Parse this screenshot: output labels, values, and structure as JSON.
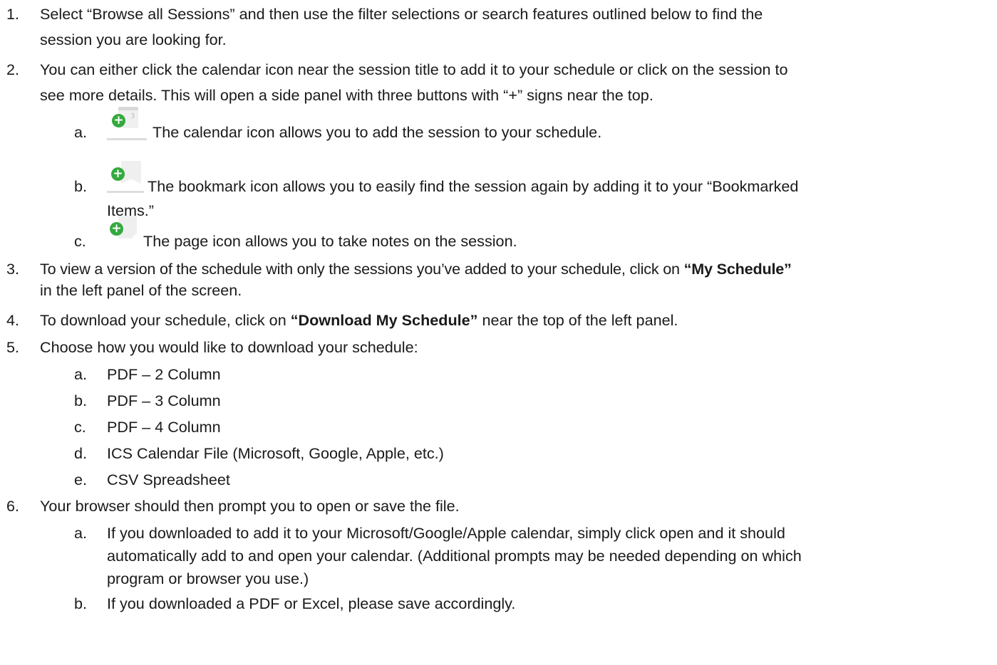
{
  "steps": [
    {
      "num": "1.",
      "line1": "Select “Browse all Sessions” and then use the filter selections or search features outlined below to find the",
      "line2": "session you are looking for."
    },
    {
      "num": "2.",
      "line1": "You can either click the calendar icon near the session title to add it to your schedule or click on the session to",
      "line2": "see more details. This will open a side panel with three buttons with “+” signs near the top.",
      "subs": [
        {
          "letter": "a.",
          "icon": "calendar-add-icon",
          "calendar_number": "3",
          "text": "The calendar icon allows you to add the session to your schedule."
        },
        {
          "letter": "b.",
          "icon": "bookmark-add-icon",
          "text": "The bookmark icon allows you to easily find the session again by adding it to your “Bookmarked",
          "text2": "Items.”"
        },
        {
          "letter": "c.",
          "icon": "page-add-icon",
          "text": "The page icon allows you to take notes on the session."
        }
      ]
    },
    {
      "num": "3.",
      "line1_pre": "To view a version of the schedule with only the sessions you’ve added to your schedule, click on ",
      "line1_bold": "“My Schedule”",
      "line2": "in the left panel of the screen."
    },
    {
      "num": "4.",
      "line1_pre": "To download your schedule, click on ",
      "line1_bold": "“Download My Schedule”",
      "line1_post": " near the top of the left panel."
    },
    {
      "num": "5.",
      "line1": "Choose how you would like to download your schedule:",
      "subs": [
        {
          "letter": "a.",
          "text": "PDF – 2 Column"
        },
        {
          "letter": "b.",
          "text": "PDF – 3 Column"
        },
        {
          "letter": "c.",
          "text": "PDF – 4 Column"
        },
        {
          "letter": "d.",
          "text": "ICS Calendar File (Microsoft, Google, Apple, etc.)"
        },
        {
          "letter": "e.",
          "text": "CSV Spreadsheet"
        }
      ]
    },
    {
      "num": "6.",
      "line1": "Your browser should then prompt you to open or save the file.",
      "subs": [
        {
          "letter": "a.",
          "text": "If you downloaded to add it to your Microsoft/Google/Apple calendar, simply click open and it should",
          "text2": "automatically add to and open your calendar. (Additional prompts may be needed depending on which",
          "text3": "program or browser you use.)"
        },
        {
          "letter": "b.",
          "text": "If you downloaded a PDF or Excel, please save accordingly."
        }
      ]
    }
  ],
  "colors": {
    "plus_green": "#35a93f",
    "icon_gray": "#ececec",
    "text": "#1a1a1a"
  }
}
